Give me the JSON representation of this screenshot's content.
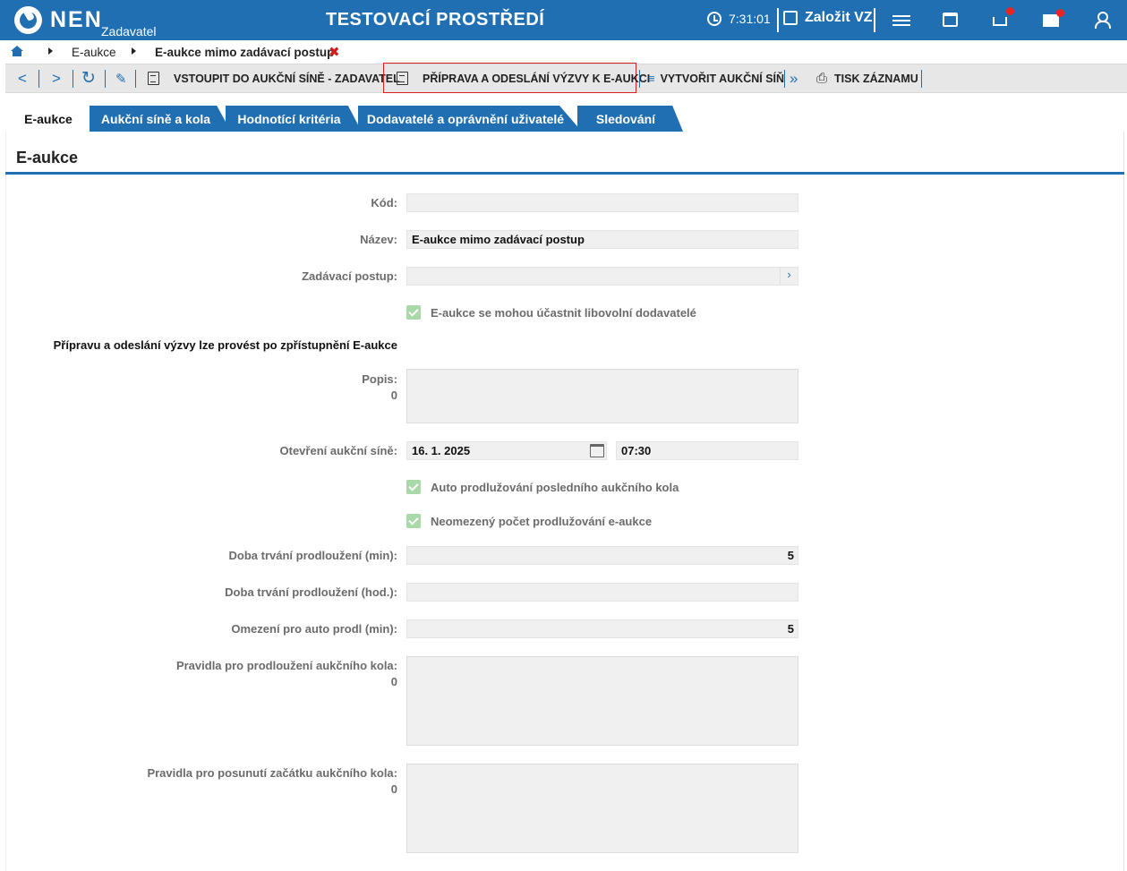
{
  "header": {
    "logo": "NEN",
    "role": "Zadavatel",
    "env_title": "TESTOVACÍ PROSTŘEDÍ",
    "time": "7:31:01",
    "create_label": "Založit VZ"
  },
  "breadcrumb": {
    "items": [
      "E-aukce",
      "E-aukce mimo zadávací postup"
    ]
  },
  "toolbar": {
    "enter_hall": "VSTOUPIT DO AUKČNÍ SÍNĚ - ZADAVATEL",
    "prepare_send": "PŘÍPRAVA A ODESLÁNÍ VÝZVY K E-AUKCI",
    "create_hall": "VYTVOŘIT AUKČNÍ SÍŇ",
    "print": "TISK ZÁZNAMU"
  },
  "tabs": [
    "E-aukce",
    "Aukční síně a kola",
    "Hodnotící kritéria",
    "Dodavatelé a oprávnění uživatelé",
    "Sledování"
  ],
  "section_title": "E-aukce",
  "form": {
    "kod_label": "Kód:",
    "kod_value": "",
    "nazev_label": "Název:",
    "nazev_value": "E-aukce mimo zadávací postup",
    "postup_label": "Zadávací postup:",
    "postup_value": "",
    "check_any_supplier": "E-aukce se mohou účastnit libovolní dodavatelé",
    "note": "Přípravu a odeslání výzvy lze provést po zpřístupnění E-aukce",
    "popis_label": "Popis:",
    "popis_count": "0",
    "open_label": "Otevření aukční síně:",
    "open_date": "16. 1. 2025",
    "open_time": "07:30",
    "check_auto_extend": "Auto prodlužování posledního aukčního kola",
    "check_unlimited": "Neomezený počet prodlužování e-aukce",
    "ext_min_label": "Doba trvání prodloužení (min):",
    "ext_min_value": "5",
    "ext_hod_label": "Doba trvání prodloužení (hod.):",
    "ext_hod_value": "",
    "limit_label": "Omezení pro auto prodl (min):",
    "limit_value": "5",
    "rules_ext_label": "Pravidla pro prodloužení aukčního kola:",
    "rules_ext_count": "0",
    "rules_shift_label": "Pravidla pro posunutí začátku aukčního kola:",
    "rules_shift_count": "0"
  },
  "colors": {
    "brand": "#1f6fb2",
    "check": "#a9d8a9",
    "highlight": "#d42222"
  }
}
